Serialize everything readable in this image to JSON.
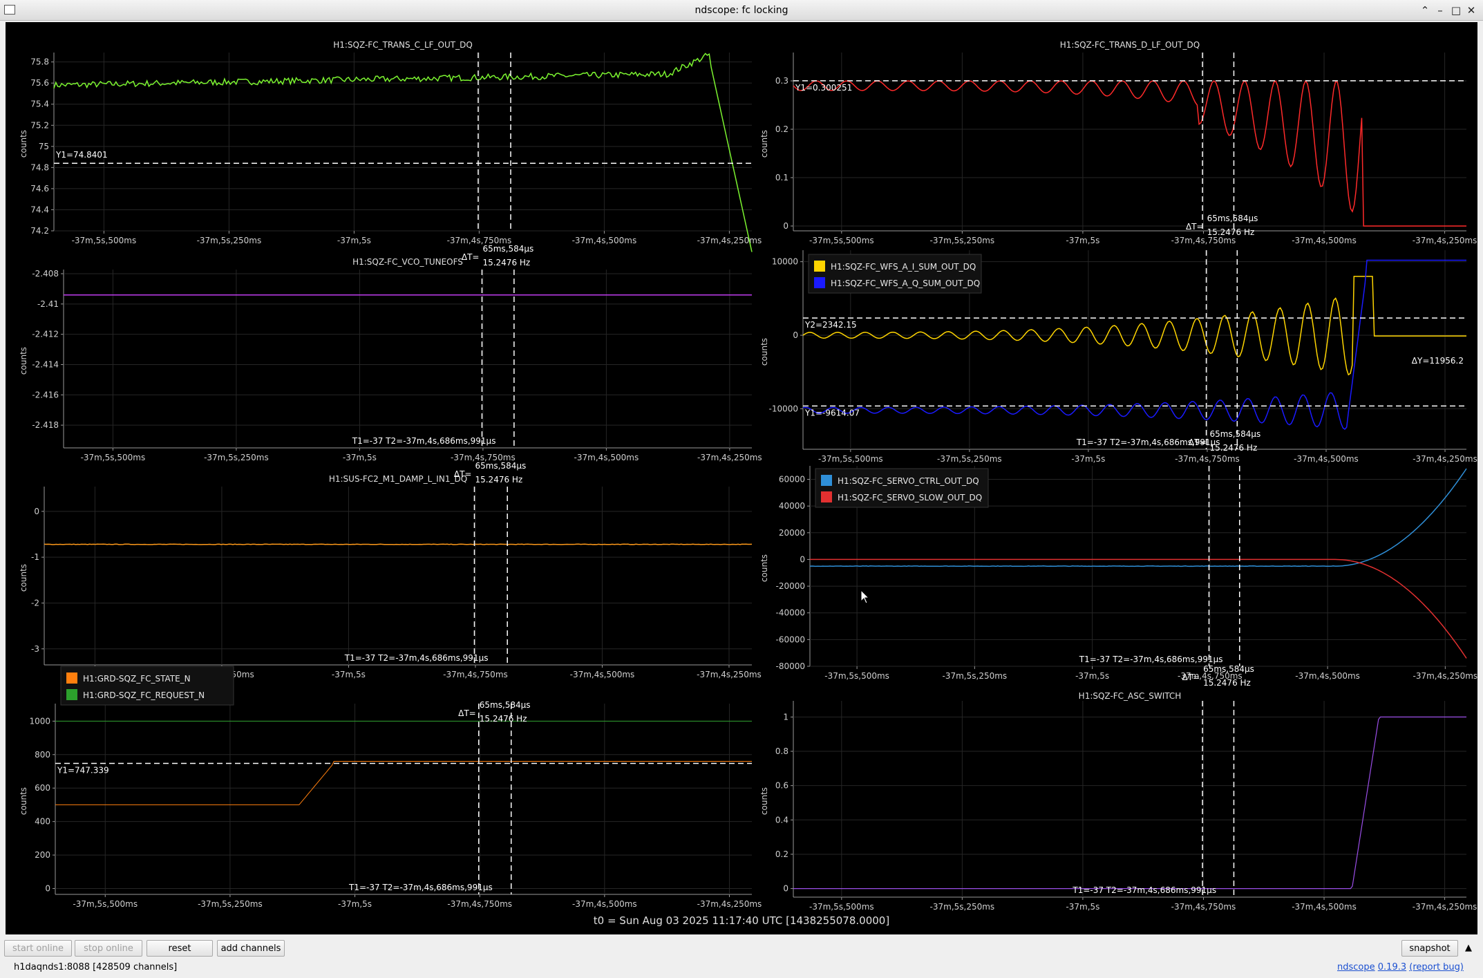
{
  "window": {
    "title": "ndscope: fc locking"
  },
  "t0_label": "t0 = Sun Aug 03 2025 11:17:40 UTC [1438255078.0000]",
  "xticks": [
    "-37m,5s,500ms",
    "-37m,5s,250ms",
    "-37m,5s",
    "-37m,4s,750ms",
    "-37m,4s,500ms",
    "-37m,4s,250ms"
  ],
  "x_range_s": [
    -2225.6,
    -2224.205
  ],
  "cursors_x_s": [
    -2224.752,
    -2224.687
  ],
  "colors": {
    "background": "#000000",
    "grid": "#262626",
    "axis_text": "#cfcfcf",
    "cursor": "#ffffff"
  },
  "cursor_info": {
    "dt_label": "ΔT=",
    "dt_value": "65ms,584μs",
    "freq": "15.2476 Hz",
    "t_readout": "T1=-37 T2=-37m,4s,686ms,991μs"
  },
  "plots": [
    {
      "title": "H1:SQZ-FC_TRANS_C_LF_OUT_DQ",
      "ylabel": "counts",
      "yticks": [
        "75.8",
        "75.6",
        "75.4",
        "75.2",
        "75",
        "74.8",
        "74.6",
        "74.4",
        "74.2"
      ],
      "ylim": [
        74.2,
        75.85
      ],
      "y1_label": "Y1=74.8401",
      "series": [
        {
          "name": "H1:SQZ-FC_TRANS_C_LF_OUT_DQ",
          "color": "#7cf530"
        }
      ]
    },
    {
      "title": "H1:SQZ-FC_TRANS_D_LF_OUT_DQ",
      "ylabel": "counts",
      "yticks": [
        "0.3",
        "0.2",
        "0.1",
        "0"
      ],
      "ylim": [
        -0.01,
        0.35
      ],
      "y1_label": "Y1=0.300251",
      "series": [
        {
          "name": "H1:SQZ-FC_TRANS_D_LF_OUT_DQ",
          "color": "#ff2a2a"
        }
      ]
    },
    {
      "title": "H1:SQZ-FC_VCO_TUNEOFS",
      "ylabel": "counts",
      "yticks": [
        "-2.408",
        "-2.41",
        "-2.412",
        "-2.414",
        "-2.416",
        "-2.418"
      ],
      "ylim": [
        -2.4195,
        -2.408
      ],
      "value": -2.4094,
      "series": [
        {
          "name": "H1:SQZ-FC_VCO_TUNEOFS",
          "color": "#c03cf0"
        }
      ]
    },
    {
      "title": "",
      "ylabel": "counts",
      "yticks": [
        "10000",
        "0",
        "-10000"
      ],
      "ylim": [
        -15500,
        11000
      ],
      "y1_label": "Y1=-9614.07",
      "y2_label": "Y2=2342.15",
      "dy_label": "ΔY=11956.2",
      "series": [
        {
          "name": "H1:SQZ-FC_WFS_A_I_SUM_OUT_DQ",
          "color": "#ffd500"
        },
        {
          "name": "H1:SQZ-FC_WFS_A_Q_SUM_OUT_DQ",
          "color": "#1a1aff"
        }
      ]
    },
    {
      "title": "H1:SUS-FC2_M1_DAMP_L_IN1_DQ",
      "ylabel": "counts",
      "yticks": [
        "0",
        "-1",
        "-2",
        "-3"
      ],
      "ylim": [
        -3.35,
        0.45
      ],
      "value": -0.72,
      "series": [
        {
          "name": "H1:SUS-FC2_M1_DAMP_L_IN1_DQ",
          "color": "#ff9a1a"
        }
      ]
    },
    {
      "title": "",
      "ylabel": "counts",
      "yticks": [
        "60000",
        "40000",
        "20000",
        "0",
        "-20000",
        "-40000",
        "-60000",
        "-80000"
      ],
      "ylim": [
        -80000,
        67000
      ],
      "series": [
        {
          "name": "H1:SQZ-FC_SERVO_CTRL_OUT_DQ",
          "color": "#2f8fd8"
        },
        {
          "name": "H1:SQZ-FC_SERVO_SLOW_OUT_DQ",
          "color": "#e23030"
        }
      ]
    },
    {
      "title": "",
      "ylabel": "counts",
      "yticks": [
        "1000",
        "800",
        "600",
        "400",
        "200",
        "0"
      ],
      "ylim": [
        -35,
        1080
      ],
      "y1_label": "Y1=747.339",
      "series": [
        {
          "name": "H1:GRD-SQZ_FC_STATE_N",
          "color": "#ff7f0e"
        },
        {
          "name": "H1:GRD-SQZ_FC_REQUEST_N",
          "color": "#2ca02c"
        }
      ]
    },
    {
      "title": "H1:SQZ-FC_ASC_SWITCH",
      "ylabel": "counts",
      "yticks": [
        "1",
        "0.8",
        "0.6",
        "0.4",
        "0.2",
        "0"
      ],
      "ylim": [
        -0.05,
        1.07
      ],
      "series": [
        {
          "name": "H1:SQZ-FC_ASC_SWITCH",
          "color": "#9b4ee8"
        }
      ]
    }
  ],
  "buttons": {
    "start_online": "start online",
    "stop_online": "stop online",
    "reset": "reset",
    "add_channels": "add channels",
    "snapshot": "snapshot"
  },
  "status": {
    "server": "h1daqnds1:8088  [428509 channels]",
    "app": "ndscope",
    "version": "0.19.3",
    "report": "(report bug)"
  }
}
